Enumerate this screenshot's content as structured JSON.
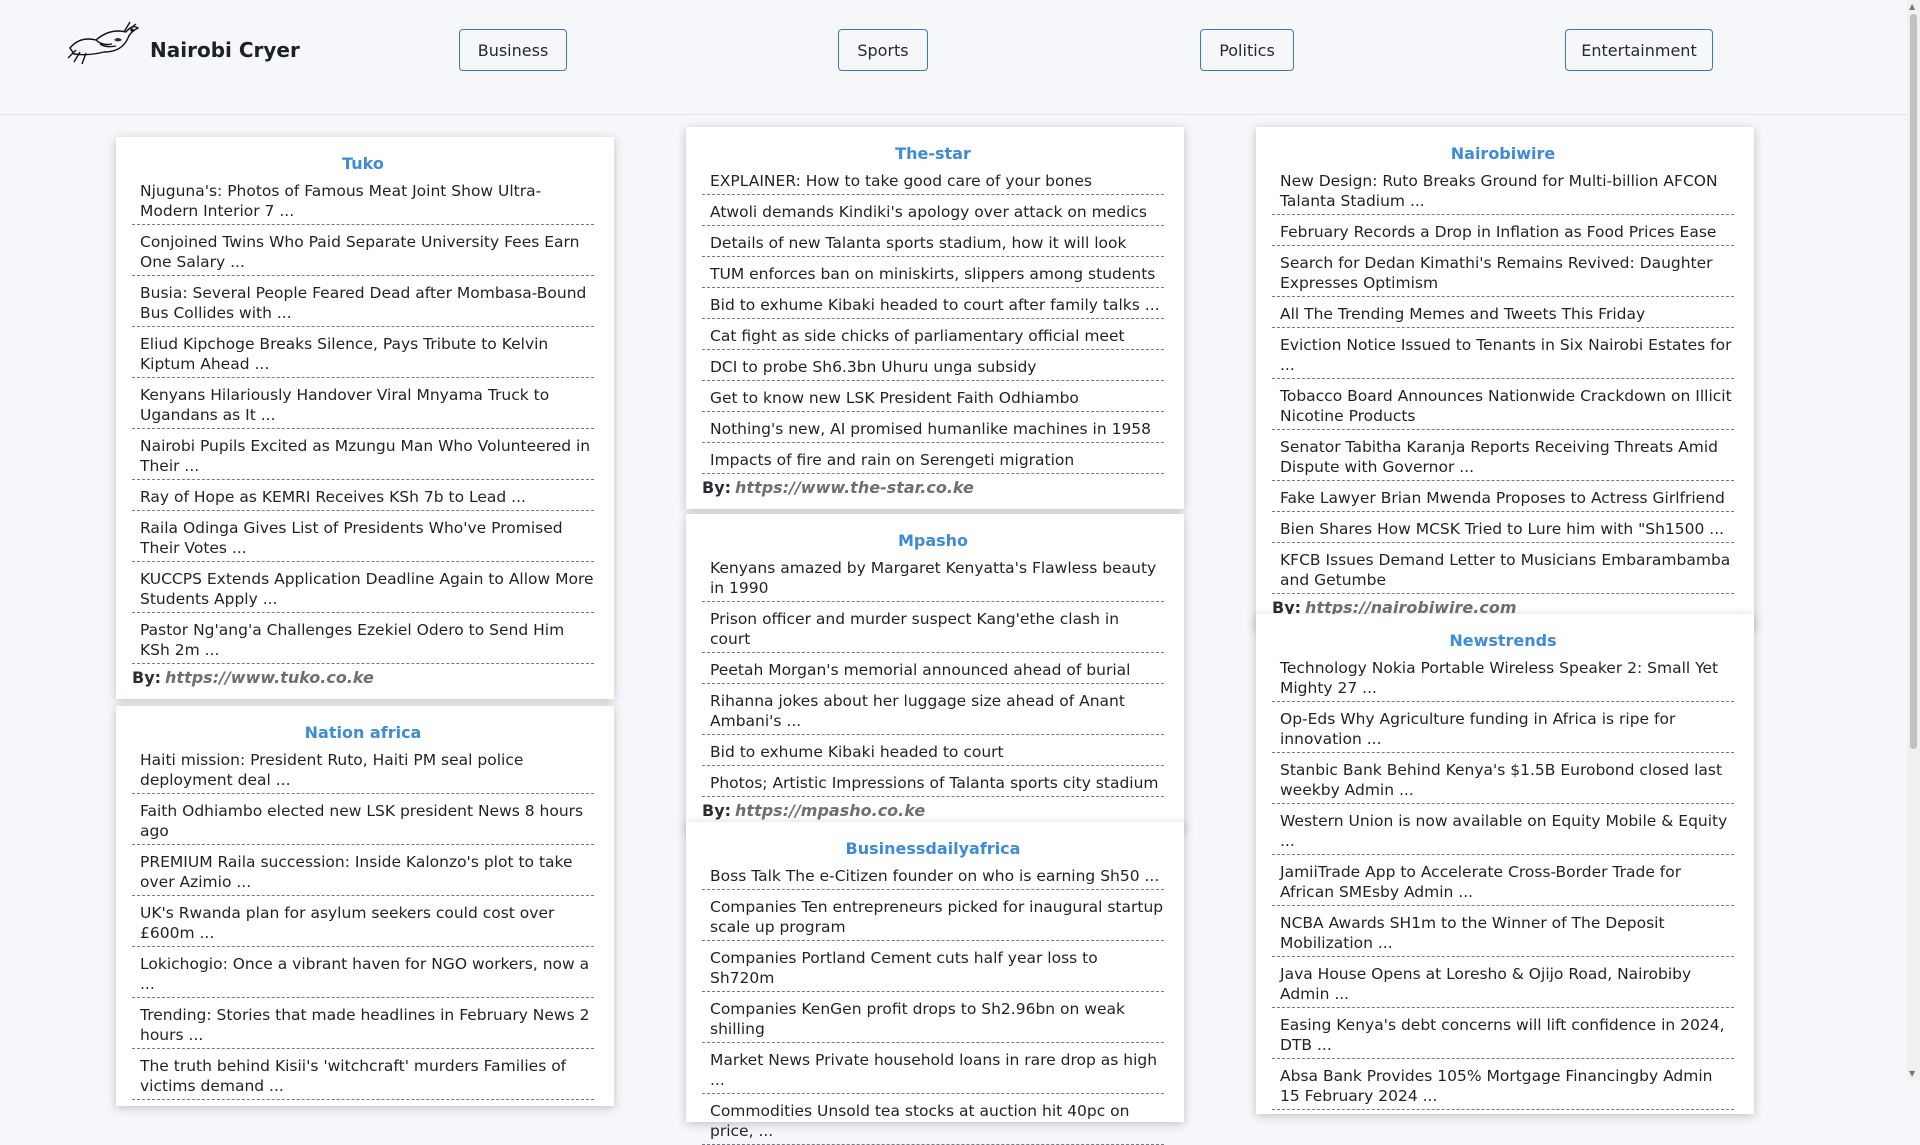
{
  "site": {
    "name": "Nairobi Cryer"
  },
  "nav": [
    "Business",
    "Sports",
    "Politics",
    "Entertainment"
  ],
  "cards": [
    {
      "title": "Tuko",
      "items": [
        "Njuguna's: Photos of Famous Meat Joint Show Ultra-Modern Interior 7 ...",
        "Conjoined Twins Who Paid Separate University Fees Earn One Salary ...",
        "Busia: Several People Feared Dead after Mombasa-Bound Bus Collides with ...",
        "Eliud Kipchoge Breaks Silence, Pays Tribute to Kelvin Kiptum Ahead ...",
        "Kenyans Hilariously Handover Viral Mnyama Truck to Ugandans as It ...",
        "Nairobi Pupils Excited as Mzungu Man Who Volunteered in Their ...",
        "Ray of Hope as KEMRI Receives KSh 7b to Lead ...",
        "Raila Odinga Gives List of Presidents Who've Promised Their Votes ...",
        "KUCCPS Extends Application Deadline Again to Allow More Students Apply ...",
        "Pastor Ng'ang'a Challenges Ezekiel Odero to Send Him KSh 2m ..."
      ],
      "by_label": "By:",
      "source": "https://www.tuko.co.ke"
    },
    {
      "title": "Nation africa",
      "items": [
        "Haiti mission: President Ruto, Haiti PM seal police deployment deal ...",
        "Faith Odhiambo elected new LSK president News 8 hours ago",
        "PREMIUM Raila succession: Inside Kalonzo's plot to take over Azimio ...",
        "UK's Rwanda plan for asylum seekers could cost over £600m ...",
        "Lokichogio: Once a vibrant haven for NGO workers, now a ...",
        "Trending: Stories that made headlines in February News 2 hours ...",
        "The truth behind Kisii's 'witchcraft' murders Families of victims demand ..."
      ]
    },
    {
      "title": "The-star",
      "items": [
        "EXPLAINER: How to take good care of your bones",
        "Atwoli demands Kindiki's apology over attack on medics",
        "Details of new Talanta sports stadium, how it will look",
        "TUM enforces ban on miniskirts, slippers among students",
        "Bid to exhume Kibaki headed to court after family talks ...",
        "Cat fight as side chicks of parliamentary official meet",
        "DCI to probe Sh6.3bn Uhuru unga subsidy",
        "Get to know new LSK President Faith Odhiambo",
        "Nothing's new, AI promised humanlike machines in 1958",
        "Impacts of fire and rain on Serengeti migration"
      ],
      "by_label": "By:",
      "source": "https://www.the-star.co.ke"
    },
    {
      "title": "Mpasho",
      "items": [
        "Kenyans amazed by Margaret Kenyatta's Flawless beauty in 1990",
        "Prison officer and murder suspect Kang'ethe clash in court",
        "Peetah Morgan's memorial announced ahead of burial",
        "Rihanna jokes about her luggage size ahead of Anant Ambani's ...",
        "Bid to exhume Kibaki headed to court",
        "Photos; Artistic Impressions of Talanta sports city stadium"
      ],
      "by_label": "By:",
      "source": "https://mpasho.co.ke"
    },
    {
      "title": "Businessdailyafrica",
      "items": [
        "Boss Talk The e-Citizen founder on who is earning Sh50 ...",
        "Companies Ten entrepreneurs picked for inaugural startup scale up program",
        "Companies Portland Cement cuts half year loss to Sh720m",
        "Companies KenGen profit drops to Sh2.96bn on weak shilling",
        "Market News Private household loans in rare drop as high ...",
        "Commodities Unsold tea stocks at auction hit 40pc on price, ..."
      ]
    },
    {
      "title": "Nairobiwire",
      "items": [
        "New Design: Ruto Breaks Ground for Multi-billion AFCON Talanta Stadium ...",
        "February Records a Drop in Inflation as Food Prices Ease",
        "Search for Dedan Kimathi's Remains Revived: Daughter Expresses Optimism",
        "All The Trending Memes and Tweets This Friday",
        "Eviction Notice Issued to Tenants in Six Nairobi Estates for ...",
        "Tobacco Board Announces Nationwide Crackdown on Illicit Nicotine Products",
        "Senator Tabitha Karanja Reports Receiving Threats Amid Dispute with Governor ...",
        "Fake Lawyer Brian Mwenda Proposes to Actress Girlfriend",
        "Bien Shares How MCSK Tried to Lure him with \"Sh1500 ...",
        "KFCB Issues Demand Letter to Musicians Embarambamba and Getumbe"
      ],
      "by_label": "By:",
      "source": "https://nairobiwire.com"
    },
    {
      "title": "Newstrends",
      "items": [
        "Technology Nokia Portable Wireless Speaker 2: Small Yet Mighty 27 ...",
        "Op-Eds Why Agriculture funding in Africa is ripe for innovation ...",
        "Stanbic Bank Behind Kenya's $1.5B Eurobond closed last weekby Admin ...",
        "Western Union is now available on Equity Mobile & Equity ...",
        "JamiiTrade App to Accelerate Cross-Border Trade for African SMEsby Admin ...",
        "NCBA Awards SH1m to the Winner of The Deposit Mobilization ...",
        "Java House Opens at Loresho & Ojijo Road, Nairobiby Admin ...",
        "Easing Kenya's debt concerns will lift confidence in 2024, DTB ...",
        "Absa Bank Provides 105% Mortgage Financingby Admin 15 February 2024 ..."
      ]
    }
  ]
}
